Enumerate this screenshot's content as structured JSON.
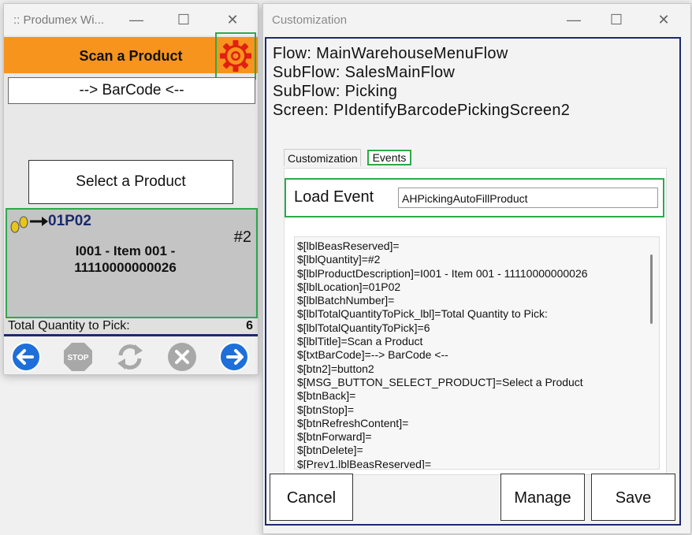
{
  "left_window": {
    "title": ":: Produmex Wi...",
    "controls": {
      "minimize": "—",
      "maximize": "☐",
      "close": "✕"
    },
    "header_title": "Scan a Product",
    "barcode_label": "--> BarCode <--",
    "select_button": "Select a Product",
    "item": {
      "location": "01P02",
      "count": "#2",
      "description_line1": "I001 - Item 001 -",
      "description_line2": "11110000000026"
    },
    "total_label": "Total Quantity to Pick:",
    "total_value": "6",
    "nav": {
      "stop_text": "STOP"
    }
  },
  "right_window": {
    "title": "Customization",
    "controls": {
      "minimize": "—",
      "maximize": "☐",
      "close": "✕"
    },
    "info": {
      "flow": "Flow: MainWarehouseMenuFlow",
      "subflow1": "SubFlow: SalesMainFlow",
      "subflow2": "SubFlow: Picking",
      "screen": "Screen: PIdentifyBarcodePickingScreen2"
    },
    "tabs": {
      "customization": "Customization",
      "events": "Events"
    },
    "load_event_label": "Load Event",
    "load_event_value": "AHPickingAutoFillProduct",
    "code_lines": [
      "$[lblBeasReserved]=",
      "$[lblQuantity]=#2",
      "$[lblProductDescription]=I001 - Item 001 - 11110000000026",
      "$[lblLocation]=01P02",
      "$[lblBatchNumber]=",
      "$[lblTotalQuantityToPick_lbl]=Total Quantity to Pick:",
      "$[lblTotalQuantityToPick]=6",
      "$[lblTitle]=Scan a Product",
      "$[txtBarCode]=--> BarCode <--",
      "$[btn2]=button2",
      "$[MSG_BUTTON_SELECT_PRODUCT]=Select a Product",
      "$[btnBack]=",
      "$[btnStop]=",
      "$[btnRefreshContent]=",
      "$[btnForward]=",
      "$[btnDelete]=",
      "$[Prev1.lblBeasReserved]="
    ],
    "buttons": {
      "cancel": "Cancel",
      "manage": "Manage",
      "save": "Save"
    }
  },
  "colors": {
    "header_orange": "#f7941d",
    "highlight_green": "#2daa4a",
    "nav_blue": "#1e6fd9",
    "border_navy": "#1e2a6b"
  }
}
